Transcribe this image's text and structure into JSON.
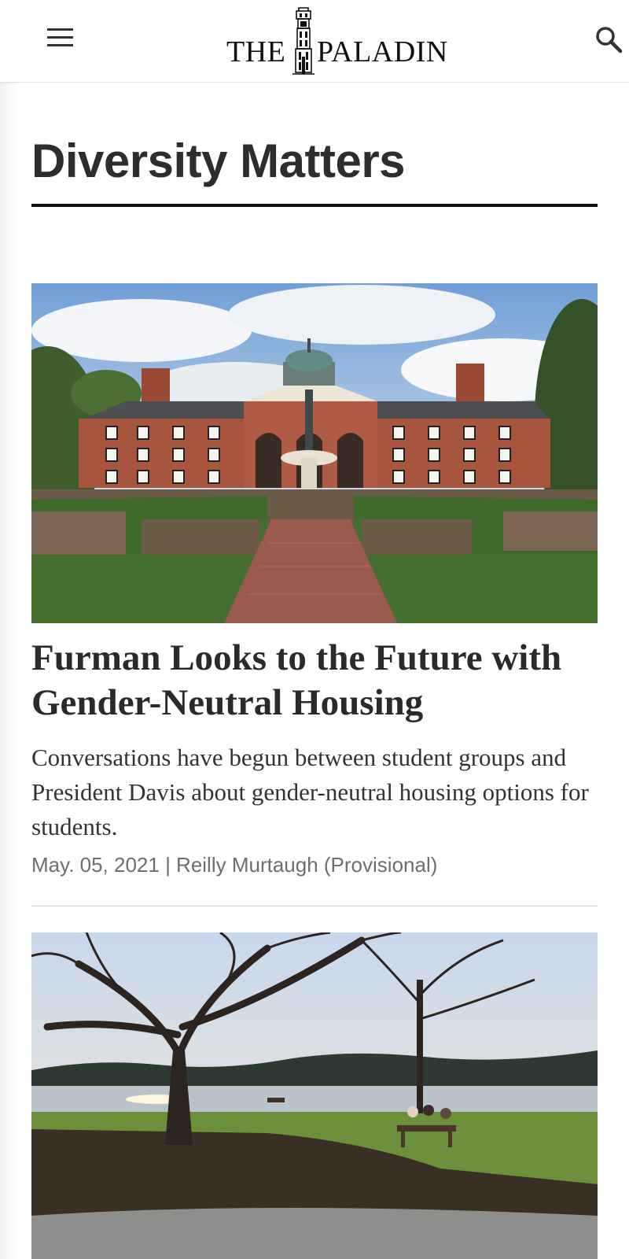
{
  "header": {
    "logo_text_left": "THE",
    "logo_text_right": "PALADIN"
  },
  "section": {
    "title": "Diversity Matters"
  },
  "articles": [
    {
      "headline": "Furman Looks to the Future with Gender-Neutral Housing",
      "dek": "Conversations have begun between student groups and President Davis about gender-neutral housing options for students.",
      "byline": "May. 05, 2021 | Reilly Murtaugh (Provisional)"
    }
  ],
  "colors": {
    "text": "#2a2a2a",
    "muted": "#6e6e6e",
    "rule": "#111111"
  }
}
